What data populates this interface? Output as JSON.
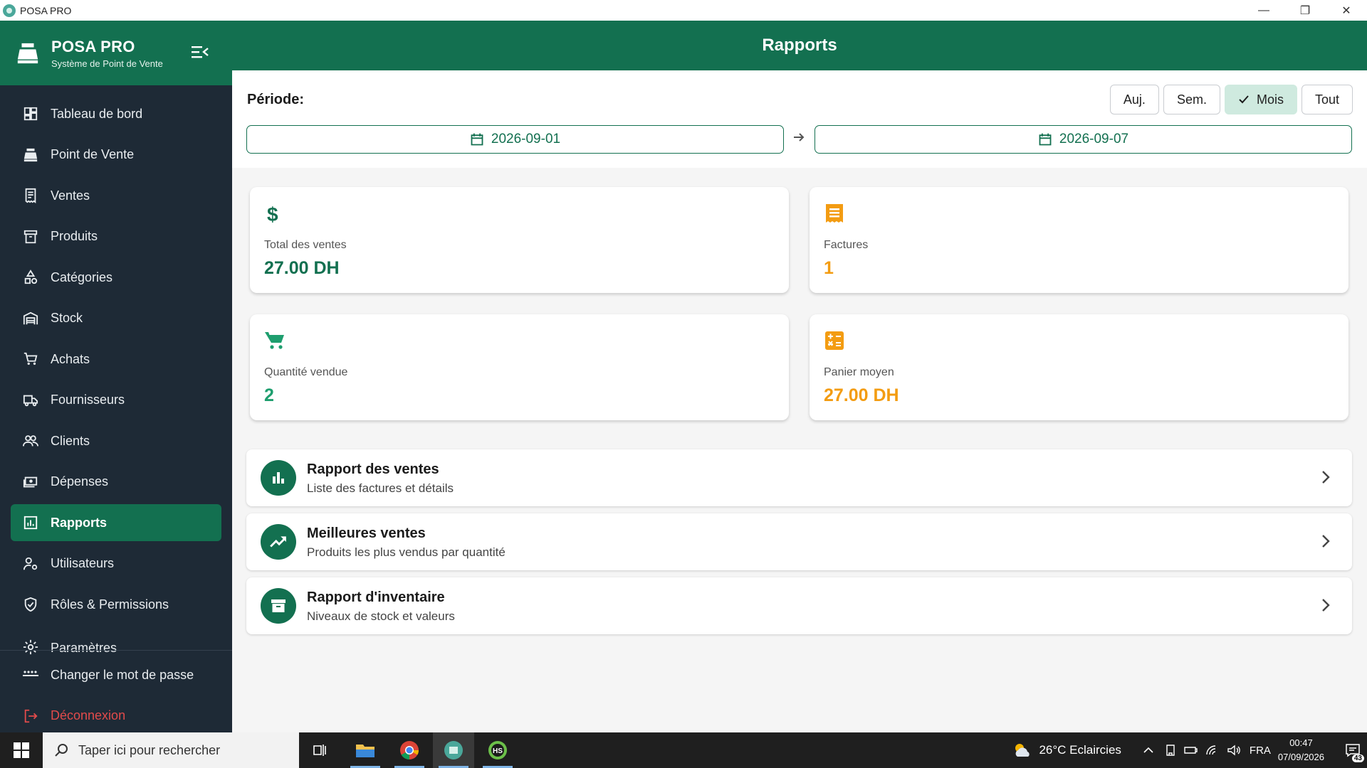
{
  "window": {
    "title": "POSA PRO",
    "minimize_glyph": "—",
    "restore_glyph": "❐",
    "close_glyph": "✕"
  },
  "brand": {
    "title": "POSA PRO",
    "subtitle": "Système de Point de Vente",
    "icon": "cash-register-icon",
    "collapse_icon": "menu-collapse-icon"
  },
  "sidebar": {
    "items": [
      {
        "label": "Tableau de bord",
        "icon": "dashboard-icon"
      },
      {
        "label": "Point de Vente",
        "icon": "cash-register-icon"
      },
      {
        "label": "Ventes",
        "icon": "receipt-icon"
      },
      {
        "label": "Produits",
        "icon": "archive-icon"
      },
      {
        "label": "Catégories",
        "icon": "category-icon"
      },
      {
        "label": "Stock",
        "icon": "warehouse-icon"
      },
      {
        "label": "Achats",
        "icon": "cart-icon"
      },
      {
        "label": "Fournisseurs",
        "icon": "truck-icon"
      },
      {
        "label": "Clients",
        "icon": "people-icon"
      },
      {
        "label": "Dépenses",
        "icon": "money-icon"
      },
      {
        "label": "Rapports",
        "icon": "report-icon",
        "active": true
      },
      {
        "label": "Utilisateurs",
        "icon": "user-settings-icon"
      },
      {
        "label": "Rôles & Permissions",
        "icon": "shield-icon"
      },
      {
        "label": "Paramètres",
        "icon": "gear-icon"
      }
    ],
    "bottom": {
      "change_password": "Changer le mot de passe",
      "logout": "Déconnexion"
    }
  },
  "header": {
    "title": "Rapports"
  },
  "filter": {
    "label": "Période:",
    "chips": [
      {
        "label": "Auj.",
        "selected": false
      },
      {
        "label": "Sem.",
        "selected": false
      },
      {
        "label": "Mois",
        "selected": true
      },
      {
        "label": "Tout",
        "selected": false
      }
    ],
    "date_from": "2026-09-01",
    "date_to": "2026-09-07"
  },
  "stats": [
    {
      "label": "Total des ventes",
      "value": "27.00 DH",
      "icon": "dollar-icon",
      "color": "#137050"
    },
    {
      "label": "Factures",
      "value": "1",
      "icon": "receipt-icon",
      "color": "#f39c12"
    },
    {
      "label": "Quantité vendue",
      "value": "2",
      "icon": "cart-icon",
      "color": "#1e9e6e"
    },
    {
      "label": "Panier moyen",
      "value": "27.00 DH",
      "icon": "calculator-icon",
      "color": "#f39c12"
    }
  ],
  "reports": [
    {
      "title": "Rapport des ventes",
      "subtitle": "Liste des factures et détails",
      "icon": "bar-chart-icon"
    },
    {
      "title": "Meilleures ventes",
      "subtitle": "Produits les plus vendus par quantité",
      "icon": "trending-up-icon"
    },
    {
      "title": "Rapport d'inventaire",
      "subtitle": "Niveaux de stock et valeurs",
      "icon": "archive-icon"
    }
  ],
  "taskbar": {
    "search_placeholder": "Taper ici pour rechercher",
    "weather": "26°C  Eclaircies",
    "language": "FRA",
    "time": "00:47",
    "date": "07/09/2026",
    "notifications": "43",
    "pinned_apps": [
      "task-view-icon",
      "file-explorer-icon",
      "chrome-icon",
      "posa-pro-icon",
      "hs-app-icon"
    ]
  },
  "colors": {
    "primary": "#137050",
    "sidebar_bg": "#1e2a36",
    "accent_orange": "#f39c12",
    "logout_red": "#e24b4b"
  }
}
